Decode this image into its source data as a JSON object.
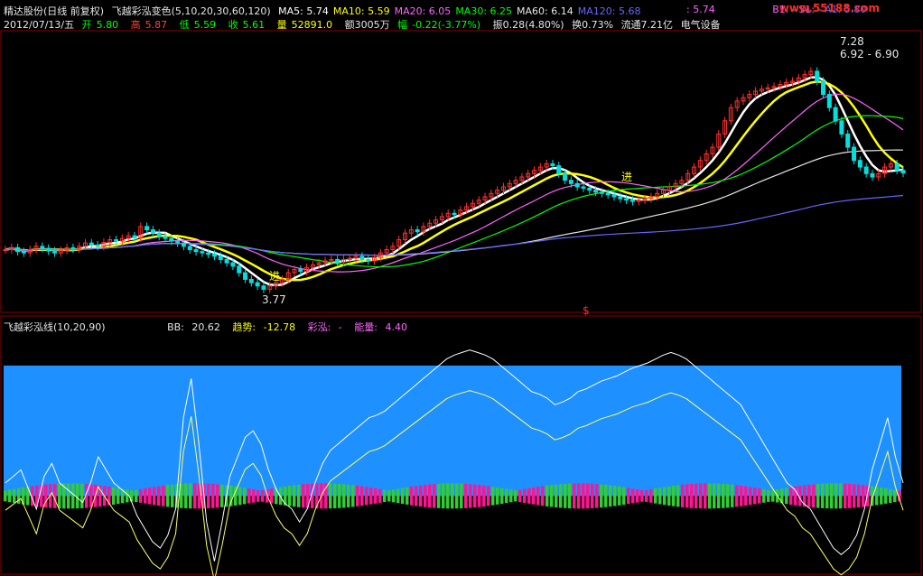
{
  "header": {
    "title": "精达股份(日线 前复权)",
    "indicator": "飞越彩泓变色(5,10,20,30,60,120)",
    "ma": [
      {
        "label": "MA5:",
        "value": "5.74",
        "color": "#ffffff"
      },
      {
        "label": "MA10:",
        "value": "5.59",
        "color": "#ffff00"
      },
      {
        "label": "MA20:",
        "value": "6.05",
        "color": "#ff66ff"
      },
      {
        "label": "MA30:",
        "value": "6.25",
        "color": "#00ff00"
      },
      {
        "label": "MA60:",
        "value": "6.14",
        "color": "#e6e6e6"
      },
      {
        "label": "MA120:",
        "value": "5.68",
        "color": "#6666ff"
      }
    ],
    "right_value": ": 5.74",
    "right_b1": "B1: -",
    "right_s1": "S1: -",
    "right_a1": "A1: 5.80",
    "watermark": "www.55188.com"
  },
  "quote": {
    "date": "2012/07/13/五",
    "open_label": "开",
    "open": "5.80",
    "high_label": "高",
    "high": "5.87",
    "low_label": "低",
    "low": "5.59",
    "close_label": "收",
    "close": "5.61",
    "vol_label": "量",
    "vol": "52891.0",
    "amount": "额3005万",
    "change_label": "幅",
    "change": "-0.22(-3.77%)",
    "swing": "振0.28(4.80%)",
    "turnover": "换0.73%",
    "float": "流通7.21亿",
    "sector": "电气设备"
  },
  "lower": {
    "title": "飞越彩泓线(10,20,90)",
    "bb_label": "BB:",
    "bb": "20.62",
    "trend_label": "趋势:",
    "trend": "-12.78",
    "caihong_label": "彩泓:",
    "caihong": "-",
    "energy_label": "能量:",
    "energy": "4.40"
  },
  "chart_data": [
    {
      "type": "candlestick",
      "panel": "price",
      "annotations": [
        "进",
        "进",
        "7.28",
        "6.92 - 6.90",
        "3.77",
        "$"
      ],
      "ylim": [
        3.5,
        7.6
      ],
      "close": [
        4.45,
        4.48,
        4.42,
        4.4,
        4.45,
        4.5,
        4.47,
        4.43,
        4.4,
        4.44,
        4.48,
        4.46,
        4.5,
        4.55,
        4.52,
        4.5,
        4.56,
        4.6,
        4.58,
        4.62,
        4.66,
        4.63,
        4.8,
        4.75,
        4.7,
        4.65,
        4.62,
        4.58,
        4.55,
        4.5,
        4.45,
        4.42,
        4.4,
        4.38,
        4.35,
        4.3,
        4.25,
        4.2,
        4.1,
        4.0,
        3.95,
        3.9,
        3.85,
        3.9,
        3.95,
        4.0,
        4.1,
        4.15,
        4.12,
        4.18,
        4.22,
        4.25,
        4.28,
        4.3,
        4.26,
        4.3,
        4.32,
        4.35,
        4.3,
        4.28,
        4.33,
        4.4,
        4.45,
        4.5,
        4.6,
        4.7,
        4.75,
        4.72,
        4.8,
        4.85,
        4.9,
        4.95,
        5.0,
        4.98,
        5.05,
        5.1,
        5.15,
        5.2,
        5.25,
        5.3,
        5.35,
        5.4,
        5.45,
        5.5,
        5.55,
        5.6,
        5.65,
        5.7,
        5.75,
        5.72,
        5.6,
        5.5,
        5.45,
        5.4,
        5.38,
        5.35,
        5.32,
        5.3,
        5.28,
        5.25,
        5.22,
        5.2,
        5.18,
        5.2,
        5.22,
        5.25,
        5.3,
        5.35,
        5.4,
        5.45,
        5.5,
        5.6,
        5.7,
        5.8,
        5.9,
        6.0,
        6.2,
        6.4,
        6.6,
        6.7,
        6.75,
        6.8,
        6.85,
        6.88,
        6.9,
        6.92,
        6.95,
        6.98,
        7.0,
        7.05,
        7.1,
        7.15,
        7.0,
        6.8,
        6.6,
        6.4,
        6.2,
        6.0,
        5.8,
        5.7,
        5.6,
        5.55,
        5.6,
        5.7,
        5.75,
        5.65,
        5.61
      ],
      "series": [
        {
          "name": "MA5",
          "color": "#ffffff"
        },
        {
          "name": "MA10",
          "color": "#ffff00"
        },
        {
          "name": "MA20",
          "color": "#ff66ff"
        },
        {
          "name": "MA30",
          "color": "#00ff00"
        },
        {
          "name": "MA60",
          "color": "#e6e6e6"
        },
        {
          "name": "MA120",
          "color": "#6666ff"
        }
      ]
    },
    {
      "type": "area",
      "panel": "indicator",
      "ylim": [
        -60,
        120
      ],
      "fill_level": 100,
      "fill_color": "#1e90ff",
      "trend_line": [
        10,
        15,
        20,
        5,
        -10,
        15,
        25,
        10,
        5,
        0,
        -5,
        10,
        30,
        20,
        10,
        5,
        0,
        -15,
        -25,
        -35,
        -40,
        -30,
        -10,
        60,
        90,
        40,
        -20,
        -50,
        -20,
        15,
        30,
        45,
        50,
        40,
        20,
        5,
        -5,
        -10,
        -20,
        -10,
        10,
        25,
        35,
        40,
        45,
        50,
        55,
        60,
        62,
        65,
        70,
        75,
        80,
        85,
        90,
        95,
        100,
        105,
        108,
        110,
        112,
        110,
        108,
        105,
        100,
        95,
        90,
        85,
        80,
        78,
        75,
        70,
        72,
        75,
        80,
        82,
        85,
        88,
        90,
        92,
        95,
        98,
        100,
        102,
        105,
        108,
        110,
        108,
        105,
        100,
        95,
        90,
        85,
        80,
        75,
        70,
        60,
        50,
        40,
        30,
        20,
        10,
        5,
        -5,
        -10,
        -20,
        -30,
        -40,
        -45,
        -40,
        -30,
        -10,
        20,
        40,
        60,
        30,
        10
      ]
    }
  ]
}
